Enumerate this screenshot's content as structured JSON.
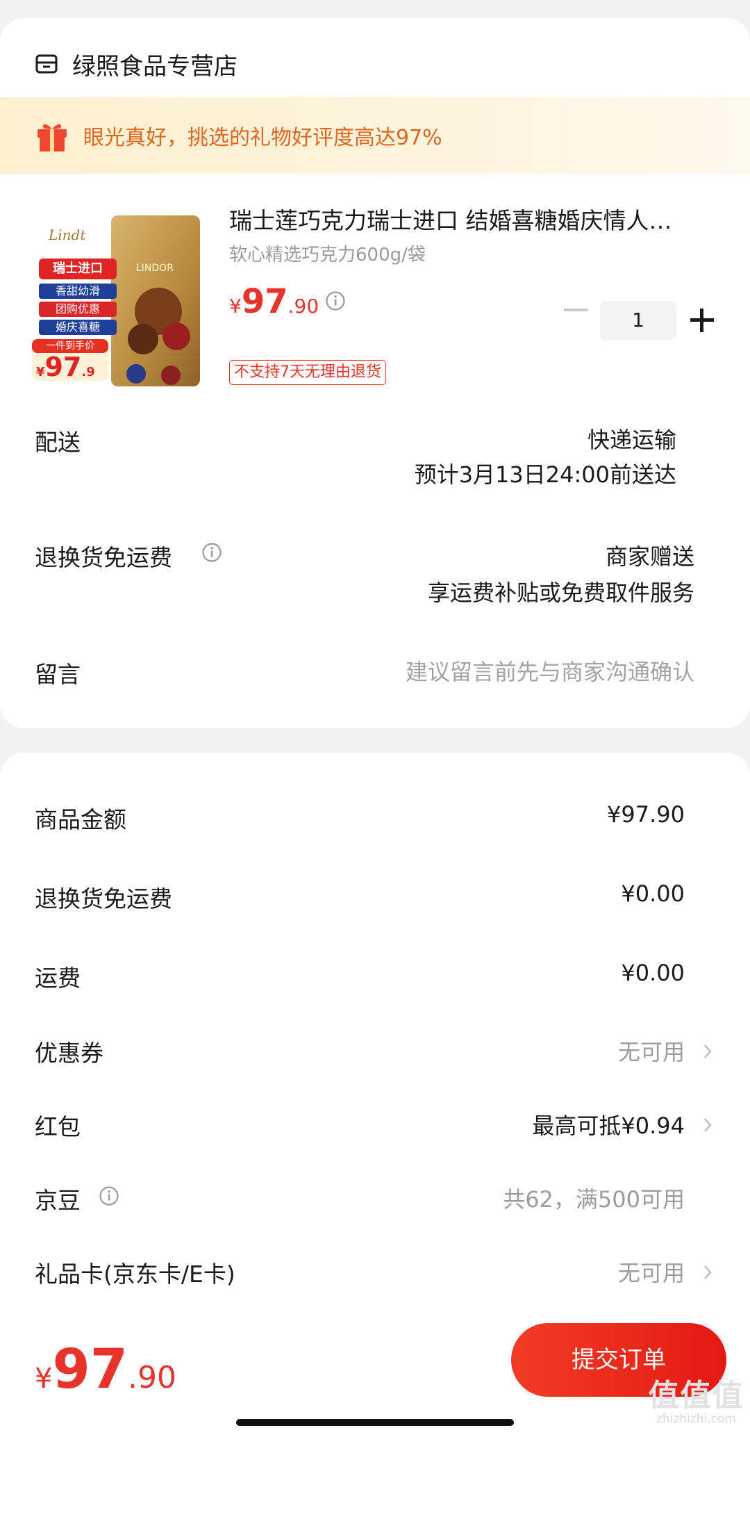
{
  "store": {
    "name": "绿照食品专营店"
  },
  "banner": {
    "text": "眼光真好，挑选的礼物好评度高达97%"
  },
  "product": {
    "image_texts": {
      "brand": "Lindt",
      "badge_import": "瑞士进口",
      "badge_taste": "香甜幼滑",
      "badge_group": "团购优惠",
      "badge_wedding": "婚庆喜糖",
      "hand_price_label": "一件到手价",
      "hand_price_cur": "¥",
      "hand_price_int": "97",
      "hand_price_dec": ".9",
      "bag_label": "LINDOR"
    },
    "title": "瑞士莲巧克力瑞士进口 结婚喜糖婚庆情人…",
    "spec": "软心精选巧克力600g/袋",
    "price_cur": "¥",
    "price_int": "97",
    "price_dec": ".90",
    "tag": "不支持7天无理由退货",
    "quantity": "1"
  },
  "delivery": {
    "label": "配送",
    "method": "快递运输",
    "eta": "预计3月13日24:00前送达"
  },
  "return_shipping": {
    "label": "退换货免运费",
    "provider": "商家赠送",
    "desc": "享运费补贴或免费取件服务"
  },
  "message": {
    "label": "留言",
    "placeholder": "建议留言前先与商家沟通确认"
  },
  "summary": [
    {
      "label": "商品金额",
      "value": "¥97.90"
    },
    {
      "label": "退换货免运费",
      "value": "¥0.00"
    },
    {
      "label": "运费",
      "value": "¥0.00"
    },
    {
      "label": "优惠券",
      "value": "无可用"
    },
    {
      "label": "红包",
      "value": "最高可抵¥0.94"
    },
    {
      "label": "京豆",
      "value": "共62，满500可用"
    },
    {
      "label": "礼品卡(京东卡/E卡)",
      "value": "无可用"
    }
  ],
  "footer": {
    "total_cur": "¥",
    "total_int": "97",
    "total_dec": ".90",
    "submit_label": "提交订单"
  },
  "watermark": {
    "big": "值值值",
    "small": "zhizhizhi.com"
  },
  "colors": {
    "accent": "#e8332b",
    "banner_text": "#e0651f"
  }
}
